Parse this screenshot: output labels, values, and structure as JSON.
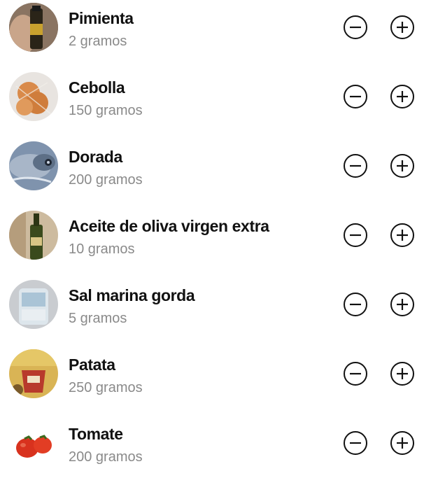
{
  "ingredients": [
    {
      "name": "Pimienta",
      "quantity": "2 gramos",
      "image_icon": "pepper-jar-photo"
    },
    {
      "name": "Cebolla",
      "quantity": "150 gramos",
      "image_icon": "onion-photo"
    },
    {
      "name": "Dorada",
      "quantity": "200 gramos",
      "image_icon": "fish-photo"
    },
    {
      "name": "Aceite de oliva virgen extra",
      "quantity": "10 gramos",
      "image_icon": "olive-oil-bottle-photo"
    },
    {
      "name": "Sal marina gorda",
      "quantity": "5 gramos",
      "image_icon": "sea-salt-photo"
    },
    {
      "name": "Patata",
      "quantity": "250 gramos",
      "image_icon": "potato-bag-photo"
    },
    {
      "name": "Tomate",
      "quantity": "200 gramos",
      "image_icon": "tomato-photo"
    }
  ],
  "controls": {
    "decrease_icon": "minus-circle-icon",
    "increase_icon": "plus-circle-icon"
  },
  "colors": {
    "name_text": "#111111",
    "quantity_text": "#8a8a8a",
    "icon_stroke": "#111111",
    "background": "#ffffff"
  }
}
